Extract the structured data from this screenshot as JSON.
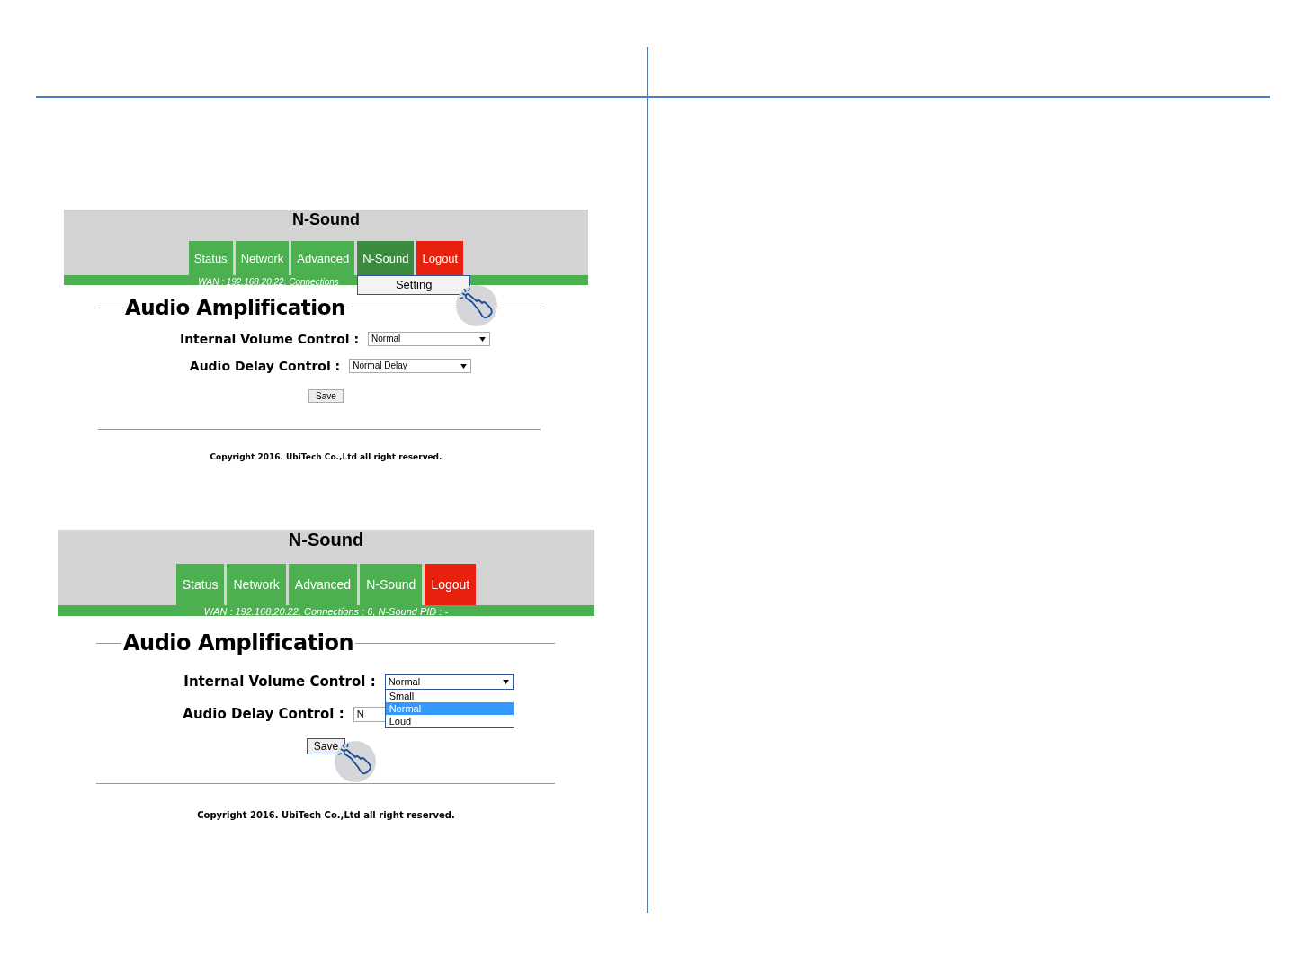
{
  "panels": [
    {
      "title": "N-Sound",
      "tabs": [
        {
          "label": "Status",
          "kind": "page",
          "selected": false
        },
        {
          "label": "Network",
          "kind": "page",
          "selected": false
        },
        {
          "label": "Advanced",
          "kind": "page",
          "selected": false
        },
        {
          "label": "N-Sound",
          "kind": "page",
          "selected": true
        },
        {
          "label": "Logout",
          "kind": "logout",
          "selected": false
        }
      ],
      "status": "WAN : 192.168.20.22, Connections",
      "menu": {
        "items": [
          "Setting"
        ],
        "pointer": true
      },
      "heading": "Audio Amplification",
      "fields": [
        {
          "label": "Internal Volume Control :",
          "value": "Normal",
          "open": false
        },
        {
          "label": "Audio Delay Control :",
          "value": "Normal Delay",
          "open": false
        }
      ],
      "save": {
        "label": "Save",
        "focused": false
      },
      "copyright": "Copyright 2016. UbiTech Co.,Ltd all right reserved."
    },
    {
      "title": "N-Sound",
      "tabs": [
        {
          "label": "Status",
          "kind": "page",
          "selected": false
        },
        {
          "label": "Network",
          "kind": "page",
          "selected": false
        },
        {
          "label": "Advanced",
          "kind": "page",
          "selected": false
        },
        {
          "label": "N-Sound",
          "kind": "page",
          "selected": false
        },
        {
          "label": "Logout",
          "kind": "logout",
          "selected": false
        }
      ],
      "status": "WAN : 192.168.20.22, Connections : 6, N-Sound PID : -",
      "heading": "Audio Amplification",
      "fields": [
        {
          "label": "Internal Volume Control :",
          "value": "Normal",
          "open": true,
          "options": [
            {
              "label": "Small",
              "selected": false
            },
            {
              "label": "Normal",
              "selected": true
            },
            {
              "label": "Loud",
              "selected": false
            }
          ]
        },
        {
          "label": "Audio Delay Control :",
          "value": "N",
          "open": false
        }
      ],
      "save": {
        "label": "Save",
        "focused": true,
        "pointer": true
      },
      "copyright": "Copyright 2016. UbiTech Co.,Ltd all right reserved."
    }
  ]
}
